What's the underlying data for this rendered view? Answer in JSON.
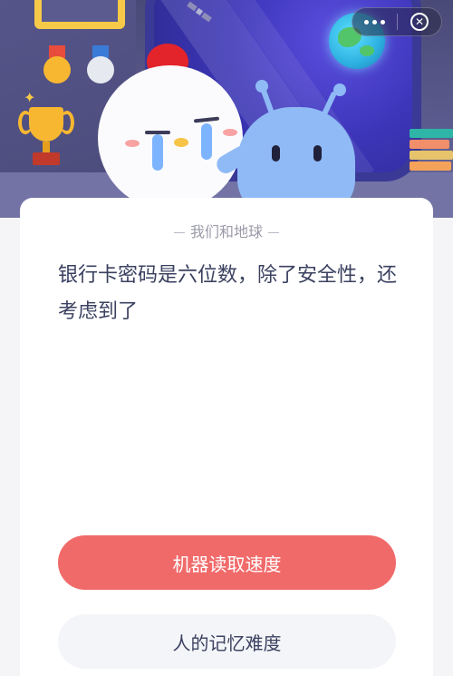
{
  "top_bar": {
    "more_icon": "more-dots-icon",
    "close_icon": "close-circle-icon"
  },
  "card": {
    "category": "我们和地球",
    "question": "银行卡密码是六位数，除了安全性，还考虑到了"
  },
  "options": [
    {
      "label": "机器读取速度",
      "style": "highlighted"
    },
    {
      "label": "人的记忆难度",
      "style": "plain"
    }
  ],
  "colors": {
    "primary_option_bg": "#f16a6a",
    "secondary_option_bg": "#f4f5f8",
    "question_text": "#3b4160",
    "scene_bg": "#4a4a78"
  }
}
